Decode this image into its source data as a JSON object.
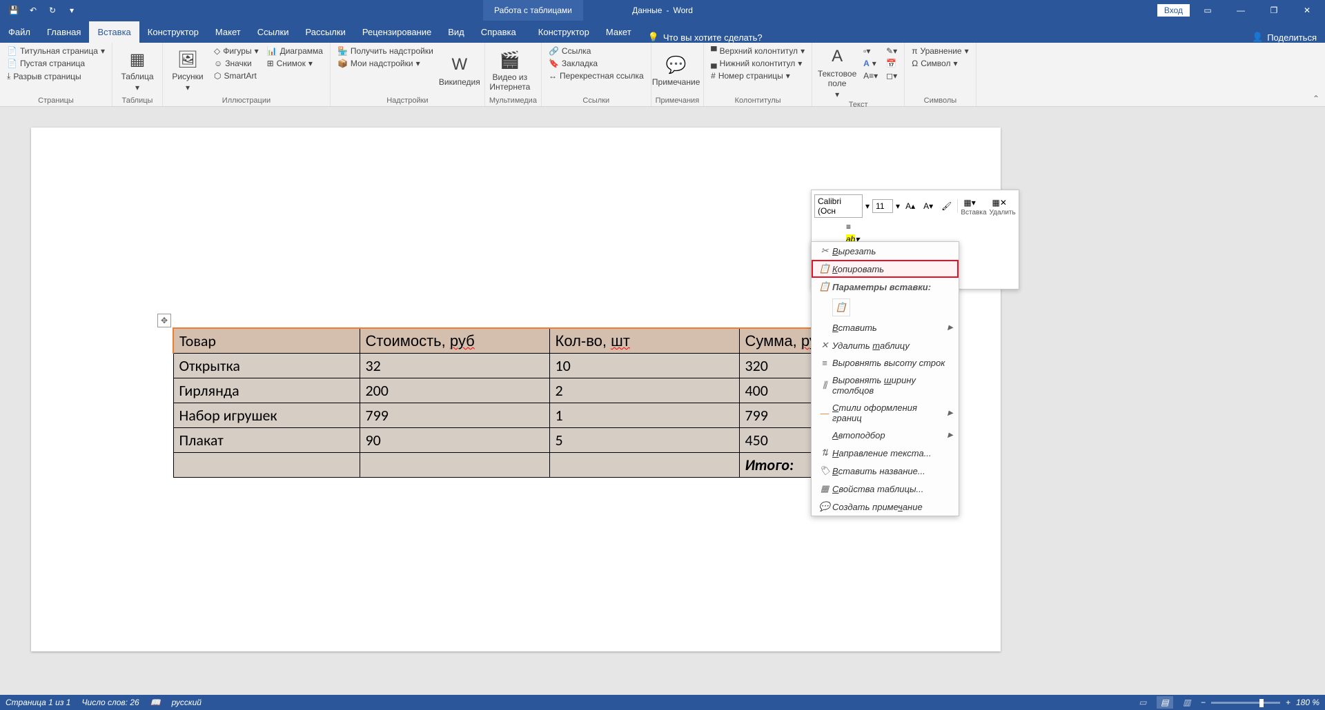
{
  "titlebar": {
    "doc_name": "Данные",
    "app_name": "Word",
    "tools_context": "Работа с таблицами",
    "login": "Вход"
  },
  "tabs": {
    "file": "Файл",
    "home": "Главная",
    "insert": "Вставка",
    "design": "Конструктор",
    "layout": "Макет",
    "references": "Ссылки",
    "mailings": "Рассылки",
    "review": "Рецензирование",
    "view": "Вид",
    "help": "Справка",
    "table_design": "Конструктор",
    "table_layout": "Макет",
    "tell_me": "Что вы хотите сделать?",
    "share": "Поделиться"
  },
  "ribbon": {
    "pages": {
      "cover": "Титульная страница",
      "blank": "Пустая страница",
      "break": "Разрыв страницы",
      "label": "Страницы"
    },
    "tables": {
      "table": "Таблица",
      "label": "Таблицы"
    },
    "illustrations": {
      "pictures": "Рисунки",
      "shapes": "Фигуры",
      "icons": "Значки",
      "smartart": "SmartArt",
      "chart": "Диаграмма",
      "screenshot": "Снимок",
      "label": "Иллюстрации"
    },
    "addins": {
      "get": "Получить надстройки",
      "my": "Мои надстройки",
      "wikipedia": "Википедия",
      "label": "Надстройки"
    },
    "media": {
      "video": "Видео из Интернета",
      "label": "Мультимедиа"
    },
    "links": {
      "link": "Ссылка",
      "bookmark": "Закладка",
      "crossref": "Перекрестная ссылка",
      "label": "Ссылки"
    },
    "comments": {
      "comment": "Примечание",
      "label": "Примечания"
    },
    "headerfooter": {
      "header": "Верхний колонтитул",
      "footer": "Нижний колонтитул",
      "pagenum": "Номер страницы",
      "label": "Колонтитулы"
    },
    "text": {
      "textbox": "Текстовое поле",
      "label": "Текст"
    },
    "symbols": {
      "equation": "Уравнение",
      "symbol": "Символ",
      "label": "Символы"
    }
  },
  "table": {
    "headers": [
      "Товар",
      "Стоимость, руб",
      "Кол-во, шт",
      "Сумма, руб."
    ],
    "rows": [
      [
        "Открытка",
        "32",
        "10",
        "320"
      ],
      [
        "Гирлянда",
        "200",
        "2",
        "400"
      ],
      [
        "Набор игрушек",
        "799",
        "1",
        "799"
      ],
      [
        "Плакат",
        "90",
        "5",
        "450"
      ]
    ],
    "total_label": "Итого:"
  },
  "mini": {
    "font": "Calibri (Осн",
    "size": "11",
    "insert": "Вставка",
    "delete": "Удалить"
  },
  "context_menu": {
    "cut": "Вырезать",
    "copy": "Копировать",
    "paste_options": "Параметры вставки:",
    "insert": "Вставить",
    "delete_table": "Удалить таблицу",
    "distribute_rows": "Выровнять высоту строк",
    "distribute_cols": "Выровнять ширину столбцов",
    "border_styles": "Стили оформления границ",
    "autofit": "Автоподбор",
    "text_direction": "Направление текста...",
    "insert_caption": "Вставить название...",
    "table_properties": "Свойства таблицы...",
    "new_comment": "Создать примечание"
  },
  "statusbar": {
    "page": "Страница 1 из 1",
    "words": "Число слов: 26",
    "language": "русский",
    "zoom": "180 %"
  }
}
